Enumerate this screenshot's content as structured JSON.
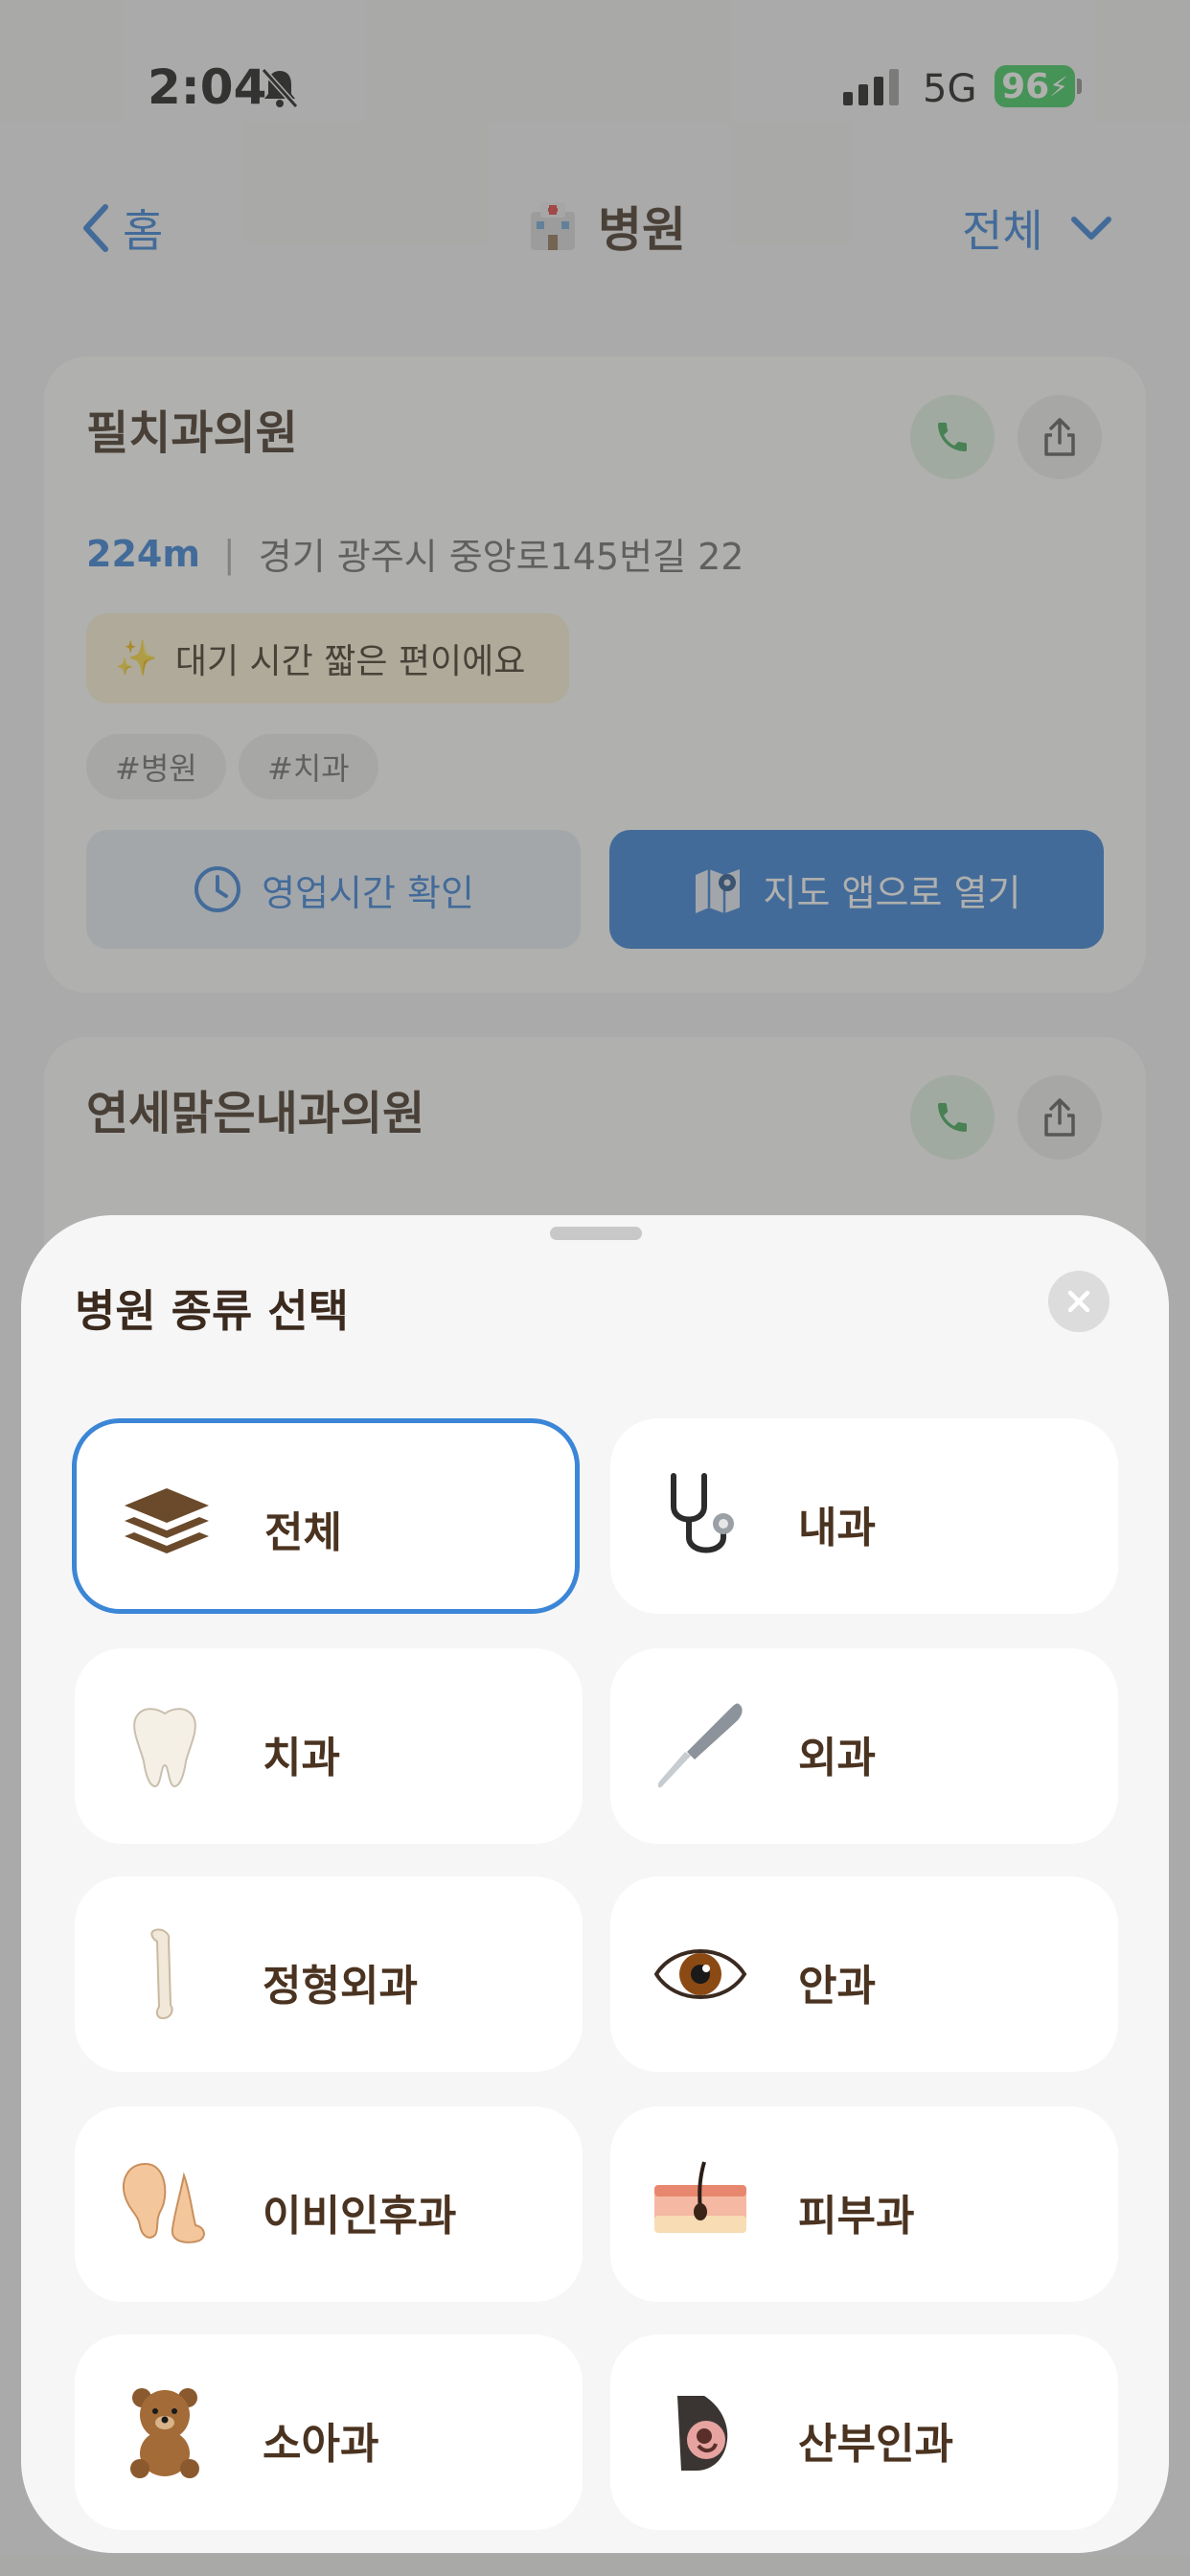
{
  "status_bar": {
    "time": "2:04",
    "network": "5G",
    "battery": "96"
  },
  "nav": {
    "back_label": "홈",
    "title": "병원",
    "filter_label": "전체"
  },
  "cards": [
    {
      "name": "필치과의원",
      "distance": "224m",
      "address": "경기 광주시 중앙로145번길 22",
      "tip": "대기 시간 짧은 편이에요",
      "tags": [
        "#병원",
        "#치과"
      ],
      "hours_button": "영업시간 확인",
      "map_button": "지도 앱으로 열기"
    },
    {
      "name": "연세맑은내과의원"
    }
  ],
  "sheet": {
    "title": "병원 종류 선택",
    "selected": "전체",
    "categories": [
      {
        "label": "전체",
        "icon": "layers-icon"
      },
      {
        "label": "내과",
        "icon": "stethoscope-icon"
      },
      {
        "label": "치과",
        "icon": "tooth-icon"
      },
      {
        "label": "외과",
        "icon": "scalpel-icon"
      },
      {
        "label": "정형외과",
        "icon": "bone-icon"
      },
      {
        "label": "안과",
        "icon": "eye-icon"
      },
      {
        "label": "이비인후과",
        "icon": "ear-nose-icon"
      },
      {
        "label": "피부과",
        "icon": "skin-icon"
      },
      {
        "label": "소아과",
        "icon": "teddy-bear-icon"
      },
      {
        "label": "산부인과",
        "icon": "pregnancy-icon"
      }
    ]
  },
  "colors": {
    "accent": "#2f7bd6",
    "text_brown": "#4a3320",
    "call_green": "#3aa655"
  }
}
